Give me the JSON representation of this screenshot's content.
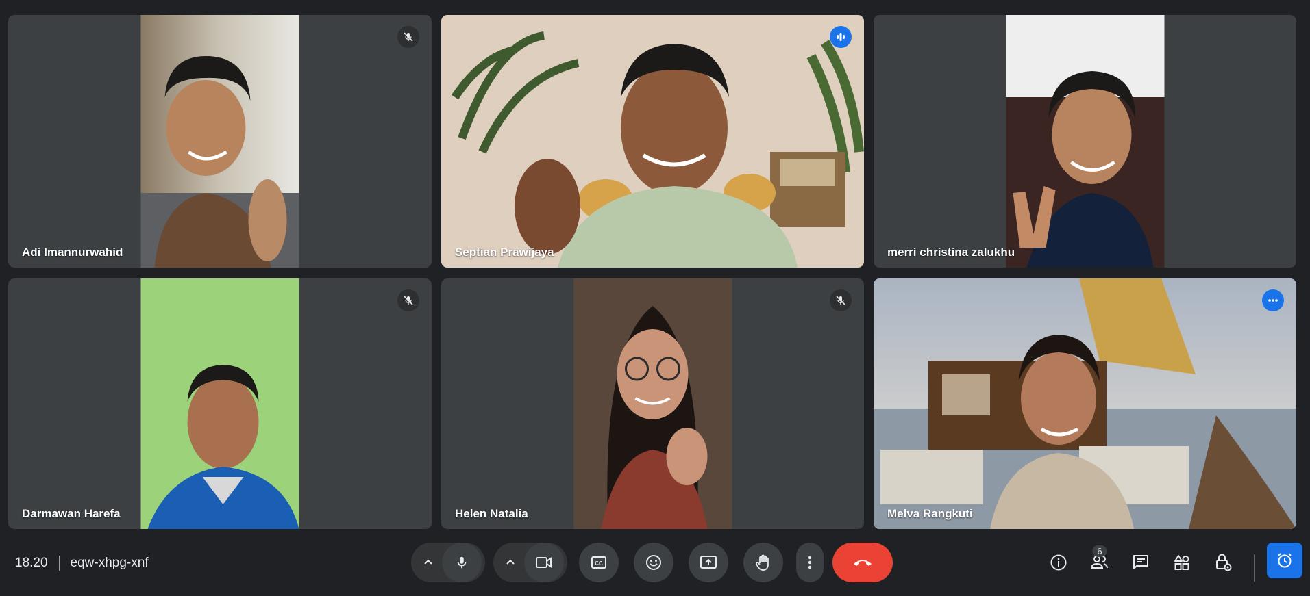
{
  "participants": [
    {
      "name": "Adi Imannurwahid",
      "muted": true
    },
    {
      "name": "Septian Prawijaya",
      "speaking": true
    },
    {
      "name": "merri christina zalukhu"
    },
    {
      "name": "Darmawan Harefa",
      "muted": true
    },
    {
      "name": "Helen Natalia",
      "muted": true
    },
    {
      "name": "Melva Rangkuti",
      "active": true
    }
  ],
  "meeting": {
    "time": "18.20",
    "code": "eqw-xhpg-xnf"
  },
  "people_count": "6",
  "colors": {
    "background": "#202124",
    "tile": "#3c4043",
    "accent": "#1a73e8",
    "end_call": "#ea4335",
    "active_outline": "#8ab4f8"
  },
  "icons": {
    "mic": "mic-icon",
    "camera": "camera-icon",
    "captions": "captions-icon",
    "emoji": "emoji-icon",
    "present": "present-screen-icon",
    "raise_hand": "raise-hand-icon",
    "more": "more-vert-icon",
    "end_call": "end-call-icon",
    "info": "info-icon",
    "people": "people-icon",
    "chat": "chat-icon",
    "activities": "activities-icon",
    "host_controls": "host-controls-icon",
    "alarm": "alarm-clock-icon"
  }
}
